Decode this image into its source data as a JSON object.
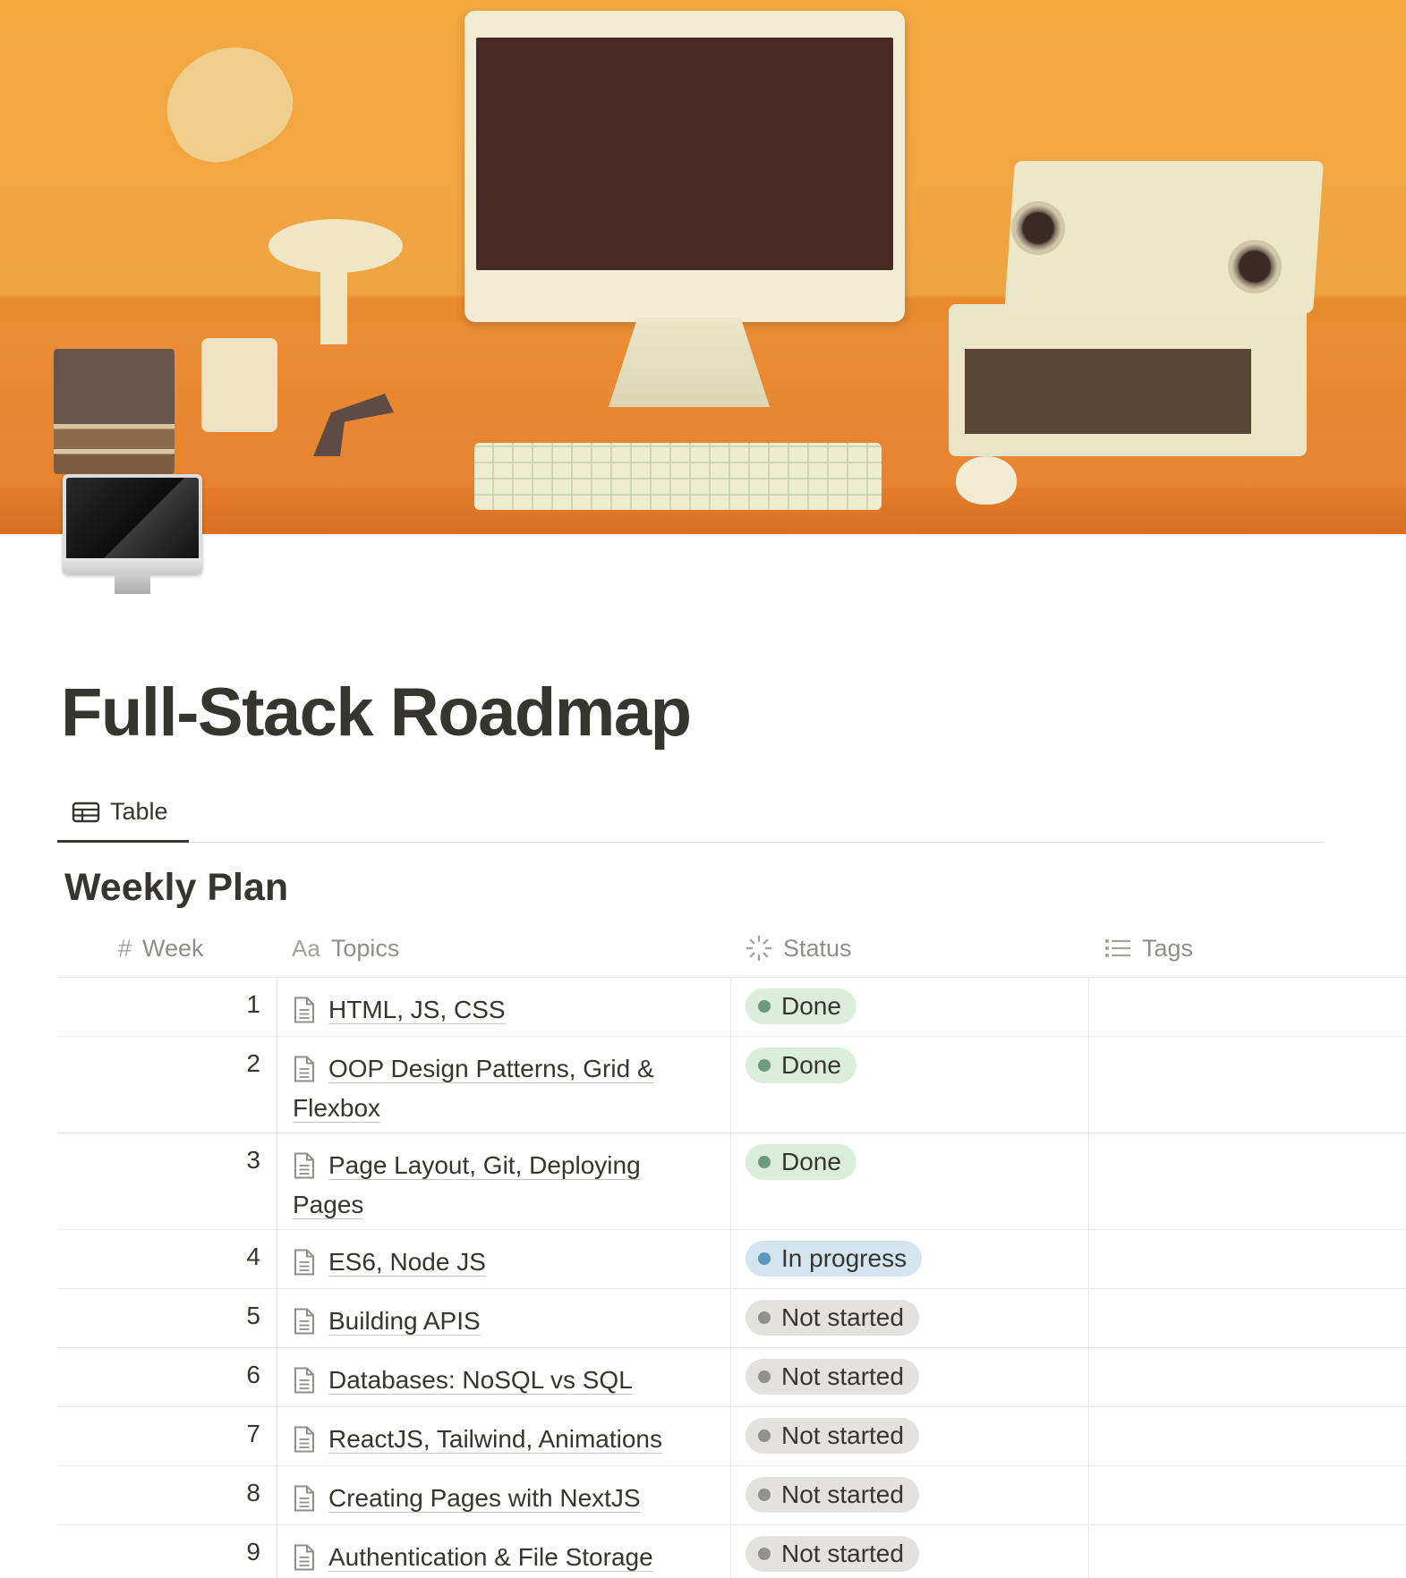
{
  "page": {
    "title": "Full-Stack Roadmap",
    "icon": "desktop-computer-icon",
    "cover": "desk-illustration"
  },
  "views": [
    {
      "label": "Table",
      "icon": "table-icon"
    }
  ],
  "database": {
    "title": "Weekly Plan",
    "columns": [
      {
        "label": "Week",
        "icon": "number-icon"
      },
      {
        "label": "Topics",
        "icon": "text-aa-icon"
      },
      {
        "label": "Status",
        "icon": "status-spinner-icon"
      },
      {
        "label": "Tags",
        "icon": "list-icon"
      }
    ],
    "rows": [
      {
        "week": "1",
        "topic": "HTML, JS, CSS",
        "status": "Done",
        "tags": ""
      },
      {
        "week": "2",
        "topic": "OOP Design Patterns, Grid & Flexbox",
        "status": "Done",
        "tags": ""
      },
      {
        "week": "3",
        "topic": "Page Layout, Git, Deploying Pages",
        "status": "Done",
        "tags": ""
      },
      {
        "week": "4",
        "topic": "ES6, Node JS",
        "status": "In progress",
        "tags": ""
      },
      {
        "week": "5",
        "topic": "Building APIS",
        "status": "Not started",
        "tags": ""
      },
      {
        "week": "6",
        "topic": "Databases: NoSQL vs SQL",
        "status": "Not started",
        "tags": ""
      },
      {
        "week": "7",
        "topic": "ReactJS, Tailwind, Animations",
        "status": "Not started",
        "tags": ""
      },
      {
        "week": "8",
        "topic": "Creating Pages with NextJS",
        "status": "Not started",
        "tags": ""
      },
      {
        "week": "9",
        "topic": "Authentication & File Storage",
        "status": "Not started",
        "tags": ""
      }
    ]
  },
  "colors": {
    "text": "#37352f",
    "muted": "#8f8e8a",
    "status_done_bg": "#dbeddb",
    "status_done_dot": "#6c9b7d",
    "status_progress_bg": "#d3e5ef",
    "status_progress_dot": "#5b97bd",
    "status_notstarted_bg": "#e3e2e0",
    "status_notstarted_dot": "#91918e"
  }
}
